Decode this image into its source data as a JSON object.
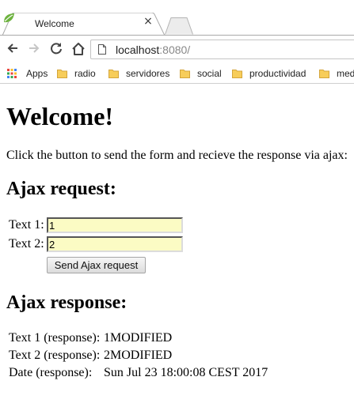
{
  "browser": {
    "tab": {
      "title": "Welcome",
      "close_glyph": "×",
      "favicon": "spring-leaf-icon"
    },
    "new_tab": "new-tab-icon",
    "address": {
      "host": "localhost",
      "port_path": ":8080/"
    },
    "bookmarks": [
      {
        "label": "Apps",
        "icon": "apps-grid-icon"
      },
      {
        "label": "radio",
        "icon": "folder-icon"
      },
      {
        "label": "servidores",
        "icon": "folder-icon"
      },
      {
        "label": "social",
        "icon": "folder-icon"
      },
      {
        "label": "productividad",
        "icon": "folder-icon"
      },
      {
        "label": "med",
        "icon": "folder-icon"
      }
    ]
  },
  "page": {
    "title": "Welcome!",
    "intro": "Click the button to send the form and recieve the response via ajax:",
    "request": {
      "heading": "Ajax request:",
      "fields": [
        {
          "label": "Text 1:",
          "value": "1"
        },
        {
          "label": "Text 2:",
          "value": "2"
        }
      ],
      "button_label": "Send Ajax request"
    },
    "response": {
      "heading": "Ajax response:",
      "rows": [
        {
          "label": "Text 1 (response):",
          "value": "1MODIFIED"
        },
        {
          "label": "Text 2 (response):",
          "value": "2MODIFIED"
        },
        {
          "label": "Date (response):",
          "value": "Sun Jul 23 18:00:08 CEST 2017"
        }
      ]
    }
  },
  "colors": {
    "input_bg": "#fbfbc4",
    "folder": "#f7cd5a"
  }
}
